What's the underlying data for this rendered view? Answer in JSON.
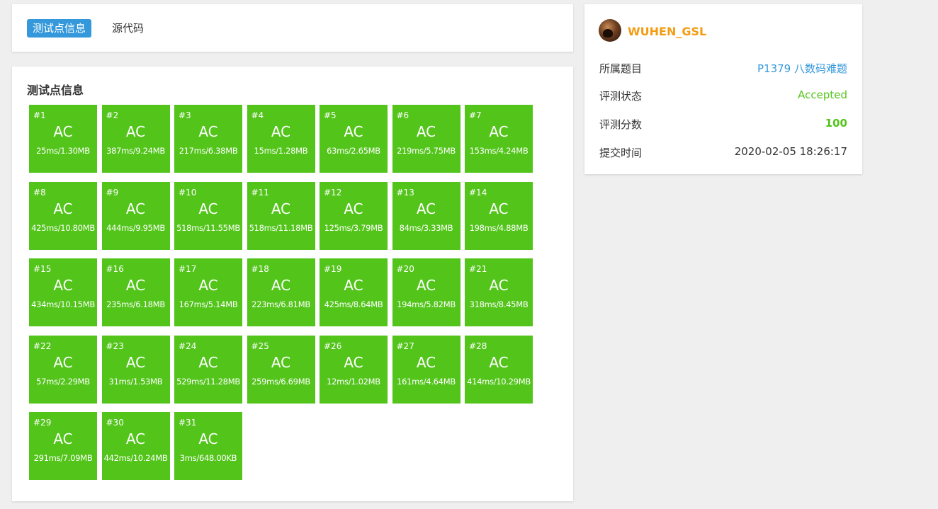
{
  "tabs": [
    {
      "label": "测试点信息",
      "active": true
    },
    {
      "label": "源代码",
      "active": false
    }
  ],
  "tests_section": {
    "title": "测试点信息",
    "cases": [
      {
        "id": "#1",
        "status": "AC",
        "usage": "25ms/1.30MB"
      },
      {
        "id": "#2",
        "status": "AC",
        "usage": "387ms/9.24MB"
      },
      {
        "id": "#3",
        "status": "AC",
        "usage": "217ms/6.38MB"
      },
      {
        "id": "#4",
        "status": "AC",
        "usage": "15ms/1.28MB"
      },
      {
        "id": "#5",
        "status": "AC",
        "usage": "63ms/2.65MB"
      },
      {
        "id": "#6",
        "status": "AC",
        "usage": "219ms/5.75MB"
      },
      {
        "id": "#7",
        "status": "AC",
        "usage": "153ms/4.24MB"
      },
      {
        "id": "#8",
        "status": "AC",
        "usage": "425ms/10.80MB"
      },
      {
        "id": "#9",
        "status": "AC",
        "usage": "444ms/9.95MB"
      },
      {
        "id": "#10",
        "status": "AC",
        "usage": "518ms/11.55MB"
      },
      {
        "id": "#11",
        "status": "AC",
        "usage": "518ms/11.18MB"
      },
      {
        "id": "#12",
        "status": "AC",
        "usage": "125ms/3.79MB"
      },
      {
        "id": "#13",
        "status": "AC",
        "usage": "84ms/3.33MB"
      },
      {
        "id": "#14",
        "status": "AC",
        "usage": "198ms/4.88MB"
      },
      {
        "id": "#15",
        "status": "AC",
        "usage": "434ms/10.15MB"
      },
      {
        "id": "#16",
        "status": "AC",
        "usage": "235ms/6.18MB"
      },
      {
        "id": "#17",
        "status": "AC",
        "usage": "167ms/5.14MB"
      },
      {
        "id": "#18",
        "status": "AC",
        "usage": "223ms/6.81MB"
      },
      {
        "id": "#19",
        "status": "AC",
        "usage": "425ms/8.64MB"
      },
      {
        "id": "#20",
        "status": "AC",
        "usage": "194ms/5.82MB"
      },
      {
        "id": "#21",
        "status": "AC",
        "usage": "318ms/8.45MB"
      },
      {
        "id": "#22",
        "status": "AC",
        "usage": "57ms/2.29MB"
      },
      {
        "id": "#23",
        "status": "AC",
        "usage": "31ms/1.53MB"
      },
      {
        "id": "#24",
        "status": "AC",
        "usage": "529ms/11.28MB"
      },
      {
        "id": "#25",
        "status": "AC",
        "usage": "259ms/6.69MB"
      },
      {
        "id": "#26",
        "status": "AC",
        "usage": "12ms/1.02MB"
      },
      {
        "id": "#27",
        "status": "AC",
        "usage": "161ms/4.64MB"
      },
      {
        "id": "#28",
        "status": "AC",
        "usage": "414ms/10.29MB"
      },
      {
        "id": "#29",
        "status": "AC",
        "usage": "291ms/7.09MB"
      },
      {
        "id": "#30",
        "status": "AC",
        "usage": "442ms/10.24MB"
      },
      {
        "id": "#31",
        "status": "AC",
        "usage": "3ms/648.00KB"
      }
    ]
  },
  "info": {
    "username": "WUHEN_GSL",
    "avatar_icon": "user-avatar",
    "rows": [
      {
        "key": "所属题目",
        "value": "P1379 八数码难题",
        "style": "link"
      },
      {
        "key": "评测状态",
        "value": "Accepted",
        "style": "accepted"
      },
      {
        "key": "评测分数",
        "value": "100",
        "style": "score"
      },
      {
        "key": "提交时间",
        "value": "2020-02-05 18:26:17",
        "style": "time"
      }
    ]
  },
  "colors": {
    "accent": "#3498db",
    "ac_green": "#52c41a",
    "username": "#f39c12",
    "background": "#efefef"
  }
}
